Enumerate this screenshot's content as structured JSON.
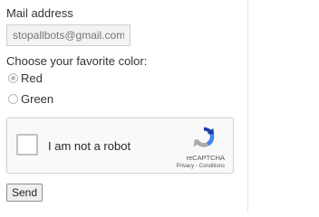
{
  "form": {
    "email_label": "Mail address",
    "email_placeholder": "stopallbots@gmail.com",
    "color_question": "Choose your favorite color:",
    "color_options": [
      {
        "label": "Red",
        "selected": true
      },
      {
        "label": "Green",
        "selected": false
      }
    ],
    "send_label": "Send"
  },
  "captcha": {
    "label": "I am not a robot",
    "brand": "reCAPTCHA",
    "links": "Privacy - Conditions",
    "icon": "recaptcha-logo-icon",
    "checked": false
  },
  "colors": {
    "input_bg": "#f3f3f3",
    "captcha_bg": "#f9f9f9",
    "recaptcha_blue": "#1c3aa9",
    "recaptcha_light_blue": "#4285f4",
    "recaptcha_gray": "#ababab"
  }
}
